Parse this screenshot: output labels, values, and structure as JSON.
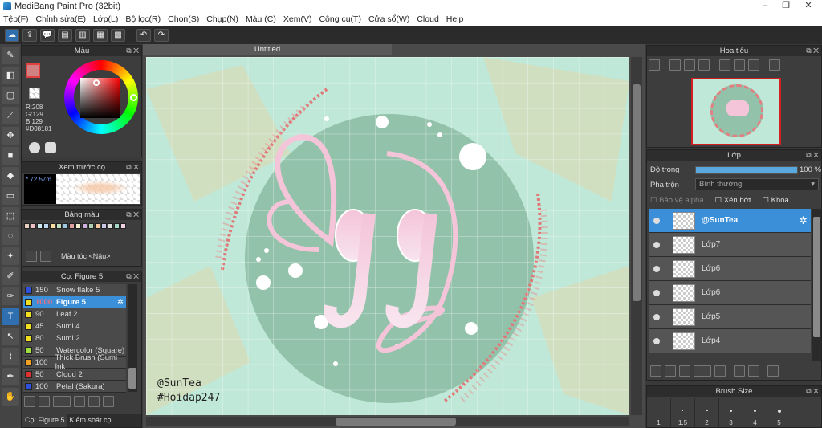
{
  "window": {
    "title": "MediBang Paint Pro (32bit)",
    "controls": [
      "–",
      "❐",
      "✕"
    ]
  },
  "menu": [
    "Tệp(F)",
    "Chỉnh sửa(E)",
    "Lớp(L)",
    "Bộ lọc(R)",
    "Chọn(S)",
    "Chụp(N)",
    "Màu (C)",
    "Xem(V)",
    "Công cụ(T)",
    "Cửa sổ(W)",
    "Cloud",
    "Help"
  ],
  "color_panel": {
    "title": "Màu",
    "r": "R:208",
    "g": "G:129",
    "b": "B:129",
    "hex": "#D08181",
    "primary_color": "#D08181"
  },
  "brush_preview": {
    "title": "Xem trước cọ",
    "size": "72.57m"
  },
  "palette": {
    "title": "Bảng màu",
    "label": "Màu tóc <Nâu>",
    "swatches": [
      "#e8d0c0",
      "#f0c0c8",
      "#d0e8f0",
      "#c0d8f0",
      "#f8e0a0",
      "#c0e0c0",
      "#a0c8e0",
      "#e0a0a0",
      "#f0f0d0",
      "#d0b0e0",
      "#b0d0b0",
      "#f8c8a0",
      "#c8c8e8",
      "#e0e0e0",
      "#a8d8c8",
      "#f0d0e0"
    ]
  },
  "brush_panel": {
    "title": "Cọ: Figure 5",
    "items": [
      {
        "size": "150",
        "name": "Snow flake 5",
        "color": "#3050e0"
      },
      {
        "size": "1000",
        "name": "Figure 5",
        "color": "#f0e020",
        "selected": true
      },
      {
        "size": "90",
        "name": "Leaf 2",
        "color": "#f0e020"
      },
      {
        "size": "45",
        "name": "Sumi 4",
        "color": "#f0e020"
      },
      {
        "size": "80",
        "name": "Sumi 2",
        "color": "#f0e020"
      },
      {
        "size": "50",
        "name": "Watercolor (Square)",
        "color": "#a0e040"
      },
      {
        "size": "100",
        "name": "Thick Brush (Sumi Ink",
        "color": "#f0a020"
      },
      {
        "size": "50",
        "name": "Cloud 2",
        "color": "#e03030"
      },
      {
        "size": "100",
        "name": "Petal (Sakura)",
        "color": "#3050e0"
      }
    ],
    "tabs": [
      "Cọ: Figure 5",
      "Kiểm soát cọ"
    ]
  },
  "document": {
    "tab": "Untitled",
    "watermark_line1": "@SunTea",
    "watermark_line2": "#Hoidap247"
  },
  "navigator": {
    "title": "Hoa tiêu"
  },
  "layers": {
    "title": "Lớp",
    "opacity_label": "Độ trong",
    "opacity_value": "100 %",
    "opacity_fraction": 1.0,
    "blend_label": "Pha trộn",
    "blend_value": "Bình thường",
    "protect_alpha": "Bảo vệ alpha",
    "clipping": "Xén bớt",
    "lock": "Khóa",
    "items": [
      "@SunTea",
      "Lớp7",
      "Lớp6",
      "Lớp6",
      "Lớp5",
      "Lớp4"
    ]
  },
  "brush_size": {
    "title": "Brush Size",
    "sizes": [
      "1",
      "1.5",
      "2",
      "3",
      "4",
      "5"
    ]
  }
}
